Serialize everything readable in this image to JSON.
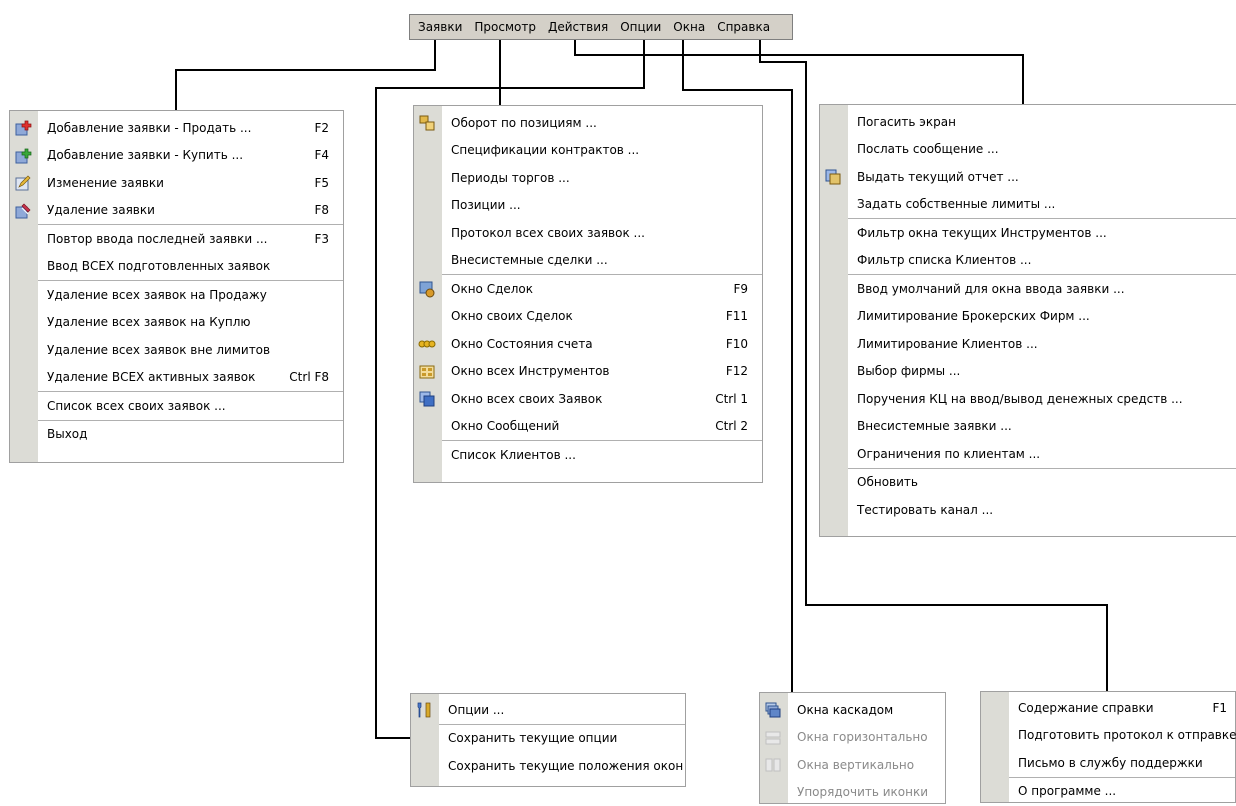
{
  "menubar": [
    "Заявки",
    "Просмотр",
    "Действия",
    "Опции",
    "Окна",
    "Справка"
  ],
  "menus": {
    "zayavki": {
      "items": [
        {
          "label": "Добавление заявки - Продать ...",
          "shortcut": "F2",
          "icon": "add-sell-icon"
        },
        {
          "label": "Добавление заявки - Купить ...",
          "shortcut": "F4",
          "icon": "add-buy-icon"
        },
        {
          "label": "Изменение  заявки",
          "shortcut": "F5",
          "icon": "edit-icon"
        },
        {
          "label": "Удаление  заявки",
          "shortcut": "F8",
          "icon": "delete-icon"
        },
        {
          "label": "Повтор ввода последней заявки ...",
          "shortcut": "F3"
        },
        {
          "label": "Ввод ВСЕХ подготовленных заявок",
          "shortcut": ""
        },
        {
          "label": "Удаление всех заявок на Продажу",
          "shortcut": ""
        },
        {
          "label": "Удаление всех заявок на Куплю",
          "shortcut": ""
        },
        {
          "label": "Удаление всех заявок вне лимитов",
          "shortcut": ""
        },
        {
          "label": "Удаление ВСЕХ активных заявок",
          "shortcut": "Ctrl F8"
        },
        {
          "label": "Список всех своих заявок ...",
          "shortcut": ""
        },
        {
          "label": "Выход",
          "shortcut": ""
        }
      ]
    },
    "prosmotr": {
      "items": [
        {
          "label": "Оборот по позициям ...",
          "shortcut": "",
          "icon": "turnover-icon"
        },
        {
          "label": "Спецификации контрактов ...",
          "shortcut": ""
        },
        {
          "label": "Периоды торгов ...",
          "shortcut": ""
        },
        {
          "label": "Позиции ...",
          "shortcut": ""
        },
        {
          "label": "Протокол всех своих заявок ...",
          "shortcut": ""
        },
        {
          "label": "Внесистемные сделки ...",
          "shortcut": ""
        },
        {
          "label": "Окно Сделок",
          "shortcut": "F9",
          "icon": "deals-icon"
        },
        {
          "label": "Окно своих Сделок",
          "shortcut": "F11"
        },
        {
          "label": "Окно Состояния счета",
          "shortcut": "F10",
          "icon": "coins-icon"
        },
        {
          "label": "Окно всех Инструментов",
          "shortcut": "F12",
          "icon": "instruments-icon"
        },
        {
          "label": "Окно всех своих Заявок",
          "shortcut": "Ctrl 1",
          "icon": "orders-icon"
        },
        {
          "label": "Окно Сообщений",
          "shortcut": "Ctrl 2"
        },
        {
          "label": "Список Клиентов ...",
          "shortcut": ""
        }
      ]
    },
    "deystviya": {
      "items": [
        {
          "label": "Погасить экран",
          "shortcut": ""
        },
        {
          "label": "Послать сообщение ...",
          "shortcut": ""
        },
        {
          "label": "Выдать текущий отчет ...",
          "shortcut": "",
          "icon": "report-icon"
        },
        {
          "label": "Задать собственные лимиты ...",
          "shortcut": ""
        },
        {
          "label": "Фильтр окна текущих Инструментов ...",
          "shortcut": ""
        },
        {
          "label": "Фильтр списка Клиентов ...",
          "shortcut": ""
        },
        {
          "label": "Ввод умолчаний для окна ввода заявки ...",
          "shortcut": ""
        },
        {
          "label": "Лимитирование Брокерских Фирм ...",
          "shortcut": ""
        },
        {
          "label": "Лимитирование Клиентов ...",
          "shortcut": ""
        },
        {
          "label": "Выбор фирмы ...",
          "shortcut": ""
        },
        {
          "label": "Поручения КЦ на ввод/вывод денежных средств ...",
          "shortcut": ""
        },
        {
          "label": "Внесистемные заявки ...",
          "shortcut": ""
        },
        {
          "label": "Ограничения по клиентам ...",
          "shortcut": ""
        },
        {
          "label": "Обновить",
          "shortcut": ""
        },
        {
          "label": "Тестировать канал ...",
          "shortcut": ""
        }
      ]
    },
    "optsii": {
      "items": [
        {
          "label": "Опции ...",
          "shortcut": "",
          "icon": "options-icon"
        },
        {
          "label": "Сохранить текущие опции",
          "shortcut": ""
        },
        {
          "label": "Сохранить текущие положения окон",
          "shortcut": ""
        }
      ]
    },
    "okna": {
      "items": [
        {
          "label": "Окна каскадом",
          "shortcut": "",
          "icon": "cascade-icon"
        },
        {
          "label": "Окна горизонтально",
          "shortcut": "",
          "icon": "tile-horizontal-icon",
          "disabled": true
        },
        {
          "label": "Окна вертикально",
          "shortcut": "",
          "icon": "tile-vertical-icon",
          "disabled": true
        },
        {
          "label": "Упорядочить иконки",
          "shortcut": "",
          "disabled": true
        }
      ]
    },
    "spravka": {
      "items": [
        {
          "label": "Содержание справки",
          "shortcut": "F1"
        },
        {
          "label": "Подготовить протокол к отправке",
          "shortcut": ""
        },
        {
          "label": "Письмо в службу поддержки",
          "shortcut": ""
        },
        {
          "label": "О программе ...",
          "shortcut": ""
        }
      ]
    }
  },
  "colors": {
    "menubar_bg": "#d4d0c8",
    "menu_bg": "#ffffff",
    "gutter": "#dcdcd6",
    "line": "#000000"
  }
}
